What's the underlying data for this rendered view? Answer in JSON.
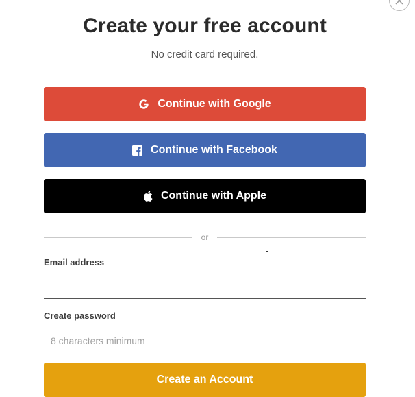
{
  "header": {
    "title": "Create your free account",
    "subtitle": "No credit card required."
  },
  "social_buttons": {
    "google": {
      "label": "Continue with Google",
      "color": "#dd4b39",
      "icon": "google-g-icon"
    },
    "facebook": {
      "label": "Continue with Facebook",
      "color": "#4267b2",
      "icon": "facebook-icon"
    },
    "apple": {
      "label": "Continue with Apple",
      "color": "#000000",
      "icon": "apple-icon"
    }
  },
  "divider": {
    "text": "or"
  },
  "form": {
    "email": {
      "label": "Email address",
      "value": "",
      "placeholder": ""
    },
    "password": {
      "label": "Create password",
      "value": "",
      "placeholder": "8 characters minimum"
    },
    "submit": {
      "label": "Create an Account",
      "color": "#e5a10e"
    }
  },
  "close": {
    "icon": "close-icon"
  }
}
